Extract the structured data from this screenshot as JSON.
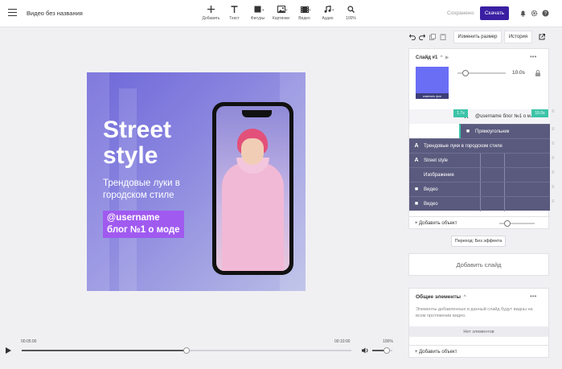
{
  "header": {
    "title": "Видео без названия",
    "tools": [
      {
        "label": "Добавить",
        "icon": "plus-icon"
      },
      {
        "label": "Текст",
        "icon": "text-icon"
      },
      {
        "label": "Фигуры",
        "icon": "shape-icon"
      },
      {
        "label": "Картинки",
        "icon": "image-icon"
      },
      {
        "label": "Видео",
        "icon": "video-icon"
      },
      {
        "label": "Аудио",
        "icon": "audio-icon"
      },
      {
        "label": "100%",
        "icon": "zoom-icon"
      }
    ],
    "saved_label": "Сохранено",
    "download_label": "Скачать",
    "accent": "#3a1fa3"
  },
  "canvas": {
    "title_line1": "Street",
    "title_line2": "style",
    "subtitle": "Трендовые луки в городском стиле",
    "tag_line1": "@username",
    "tag_line2": "блог №1 о моде",
    "bg_color": "#7a74dc",
    "tag_color": "#a05af0"
  },
  "timeline": {
    "start_time": "00:05:00",
    "end_time": "00:10:00",
    "progress": 0.5,
    "volume_label": "100%",
    "volume": 0.7
  },
  "right_panel": {
    "resize_label": "Изменить размер",
    "history_label": "История",
    "slide": {
      "title": "Слайд #1",
      "thumb_label": "изменить фон",
      "duration": "10.0s",
      "layer_tag_start": "1.7s",
      "layer_tag_end": "10.0s",
      "layers": [
        {
          "label": "@username блог №1 о м...",
          "icon": "A"
        },
        {
          "label": "Прямоугольник",
          "icon": "■"
        },
        {
          "label": "Трендовые луки в городском стиле",
          "icon": "A"
        },
        {
          "label": "Street style",
          "icon": "A"
        },
        {
          "label": "Изображение",
          "icon": ""
        },
        {
          "label": "Видео",
          "icon": "▶"
        },
        {
          "label": "Видео",
          "icon": "▶"
        }
      ],
      "add_object_label": "+ Добавить объект"
    },
    "transition_label": "Переход: Без эффекта",
    "add_slide_label": "Добавить слайд",
    "common": {
      "title": "Общие элементы",
      "description": "Элементы добавленные в данный слайд будут видны на всем протяжении видео.",
      "empty_label": "Нет элементов",
      "add_object_label": "+ Добавить объект"
    }
  }
}
